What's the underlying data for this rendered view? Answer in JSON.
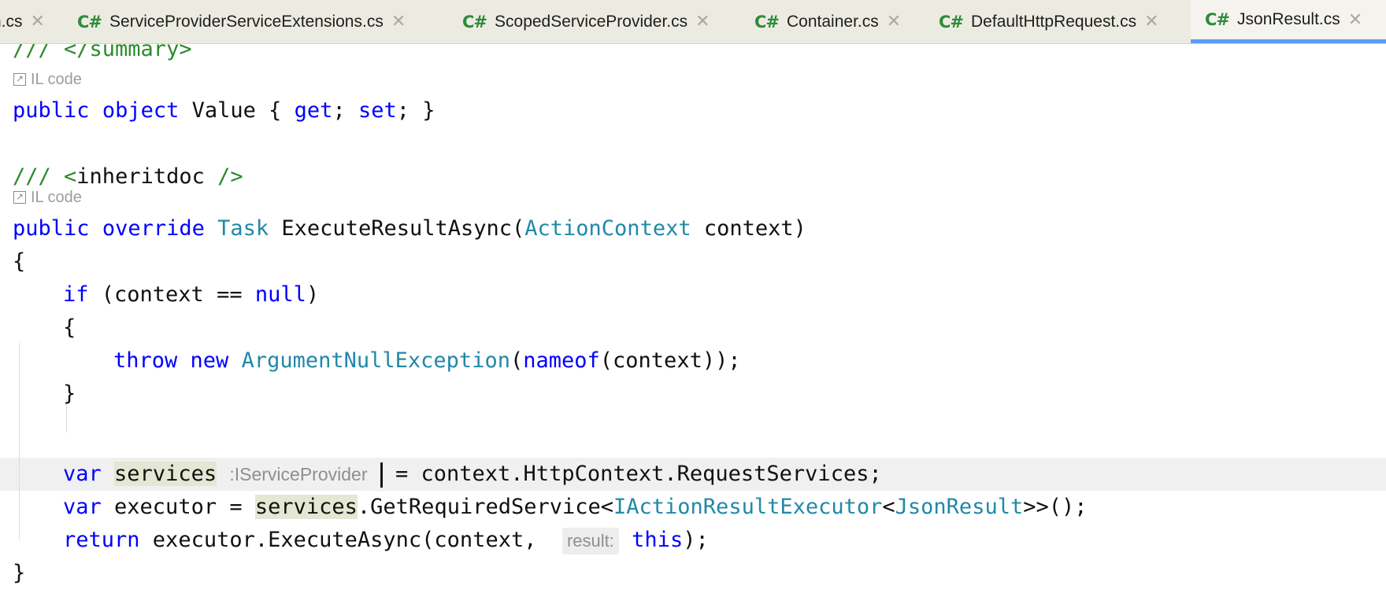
{
  "tabs": [
    {
      "label": "n.cs",
      "icon": "csharp-icon",
      "active": false
    },
    {
      "label": "ServiceProviderServiceExtensions.cs",
      "icon": "csharp-icon",
      "active": false
    },
    {
      "label": "ScopedServiceProvider.cs",
      "icon": "csharp-icon",
      "active": false
    },
    {
      "label": "Container.cs",
      "icon": "csharp-icon",
      "active": false
    },
    {
      "label": "DefaultHttpRequest.cs",
      "icon": "csharp-icon",
      "active": false
    },
    {
      "label": "JsonResult.cs",
      "icon": "csharp-icon",
      "active": true
    }
  ],
  "csharp_badge": "C#",
  "il_code_label": "IL code",
  "code": {
    "summary_close": "/// </summary>",
    "value_line": {
      "kw1": "public",
      "kw2": "object",
      "name": " Value { ",
      "get": "get",
      "semi1": "; ",
      "set": "set",
      "end": "; }"
    },
    "inheritdoc": {
      "slashes": "///",
      "open": " <",
      "tag": "inheritdoc",
      "close": " />"
    },
    "execute_line": {
      "kw1": "public",
      "kw2": "override",
      "type1": "Task",
      "method": " ExecuteResultAsync(",
      "type2": "ActionContext",
      "rest": " context)"
    },
    "brace_open": "{",
    "if_line": {
      "kw": "if",
      "cond1": " (context == ",
      "null": "null",
      "cond2": ")"
    },
    "inner_open": "{",
    "throw_line": {
      "kw1": "throw",
      "kw2": "new",
      "type": "ArgumentNullException",
      "p1": "(",
      "nameof": "nameof",
      "p2": "(context));"
    },
    "inner_close": "}",
    "services_line": {
      "kw": "var",
      "name": "services",
      "hint": ":IServiceProvider",
      "rest": " = context.HttpContext.RequestServices;"
    },
    "executor_line": {
      "kw": "var",
      "name": " executor = ",
      "svc": "services",
      "call": ".GetRequiredService<",
      "t1": "IActionResultExecutor",
      "lt": "<",
      "t2": "JsonResult",
      "end": ">>();"
    },
    "return_line": {
      "kw": "return",
      "call": " executor.ExecuteAsync(context, ",
      "param_hint": "result:",
      "this": "this",
      "end": ");"
    },
    "brace_close": "}"
  },
  "colors": {
    "keyword": "#0000ff",
    "type": "#2188a8",
    "doc_comment": "#2b8a2b",
    "active_tab_underline": "#5a9bff"
  }
}
